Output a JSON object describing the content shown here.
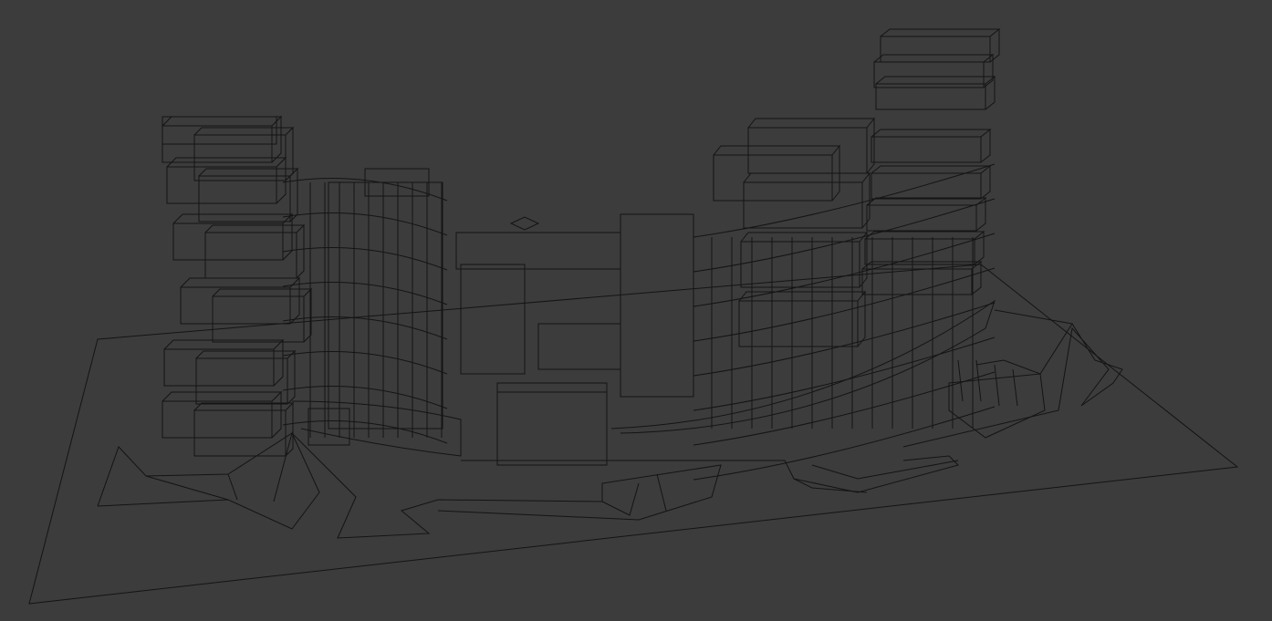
{
  "viewport": {
    "background": "#3c3c3c",
    "wire_color": "#141414",
    "render_mode": "wireframe"
  }
}
